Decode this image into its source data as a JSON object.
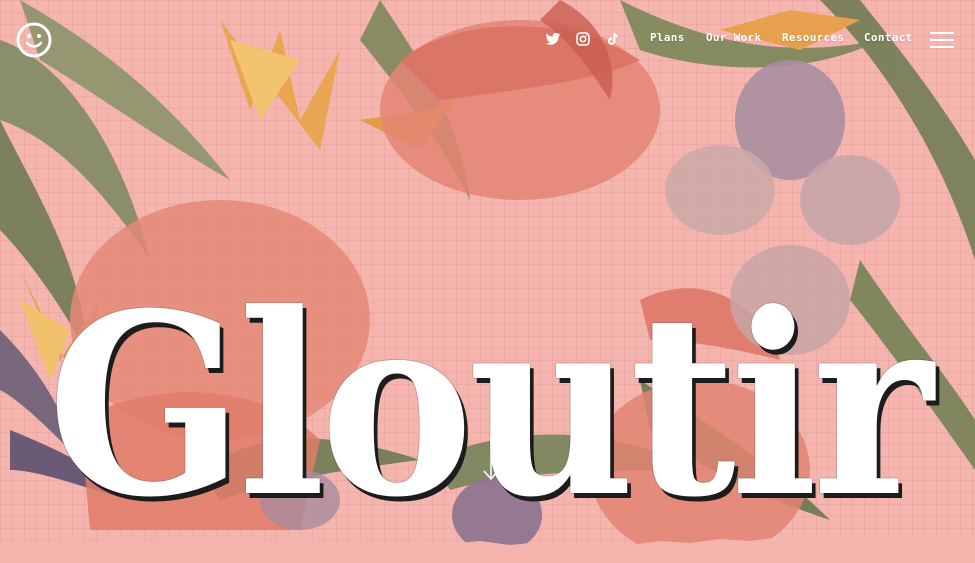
{
  "brand": {
    "title": "Gloutir",
    "logo_icon": "smiley-face-icon"
  },
  "header": {
    "social": [
      {
        "name": "twitter",
        "icon": "twitter-icon"
      },
      {
        "name": "instagram",
        "icon": "instagram-icon"
      },
      {
        "name": "tiktok",
        "icon": "tiktok-icon"
      }
    ],
    "nav": [
      {
        "label": "Plans"
      },
      {
        "label": "Our Work"
      },
      {
        "label": "Resources"
      },
      {
        "label": "Contact"
      }
    ],
    "menu_icon": "hamburger-menu-icon"
  },
  "hero": {
    "scroll_icon": "arrow-down-icon"
  },
  "colors": {
    "background": "#f5b5af",
    "text": "#ffffff",
    "shadow": "#1c1c1c",
    "torn_paper": "#f4b4ae"
  }
}
